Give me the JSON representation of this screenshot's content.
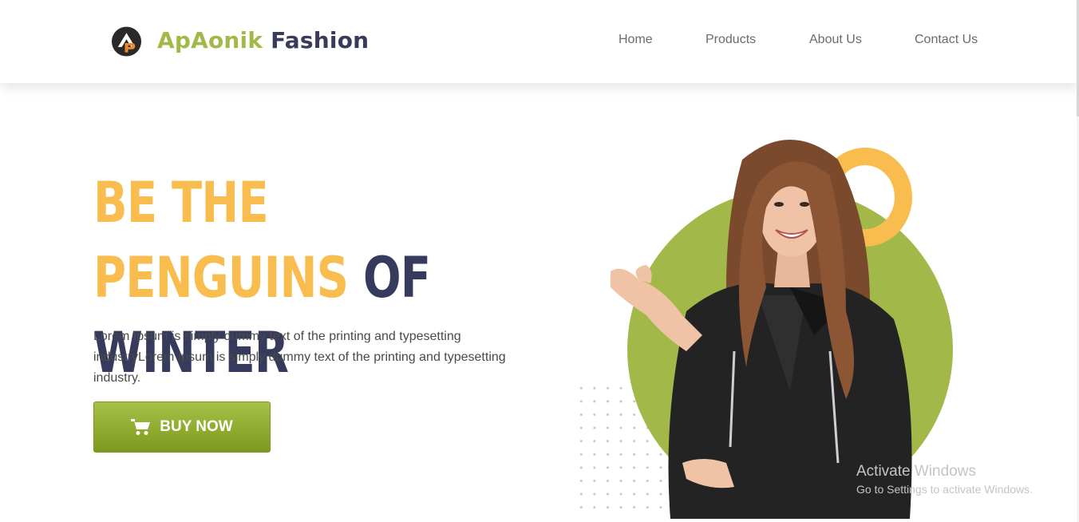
{
  "header": {
    "brand_part1": "ApAonik",
    "brand_part2": "Fashion",
    "logo_icon": "ap-logo-icon",
    "nav": [
      {
        "label": "Home"
      },
      {
        "label": "Products"
      },
      {
        "label": "About Us"
      },
      {
        "label": "Contact Us"
      }
    ]
  },
  "hero": {
    "headline_accent": "BE THE PENGUINS",
    "headline_rest_line1": "OF",
    "headline_line2": "WINTER",
    "description": "Lorem Ipsum is simply dummy text of the printing and typesetting industryLorem Ipsum is simply dummy text of the printing and typesetting industry.",
    "cta_label": "BUY NOW",
    "cta_icon": "shopping-cart-icon",
    "image_alt": "model-in-leather-jacket"
  },
  "watermark": {
    "line1": "Activate Windows",
    "line2": "Go to Settings to activate Windows."
  },
  "colors": {
    "accent_green": "#a2b94a",
    "accent_yellow": "#f8bd4e",
    "navy": "#363a5c",
    "button_top": "#a5c046",
    "button_bottom": "#7e9a1e"
  }
}
